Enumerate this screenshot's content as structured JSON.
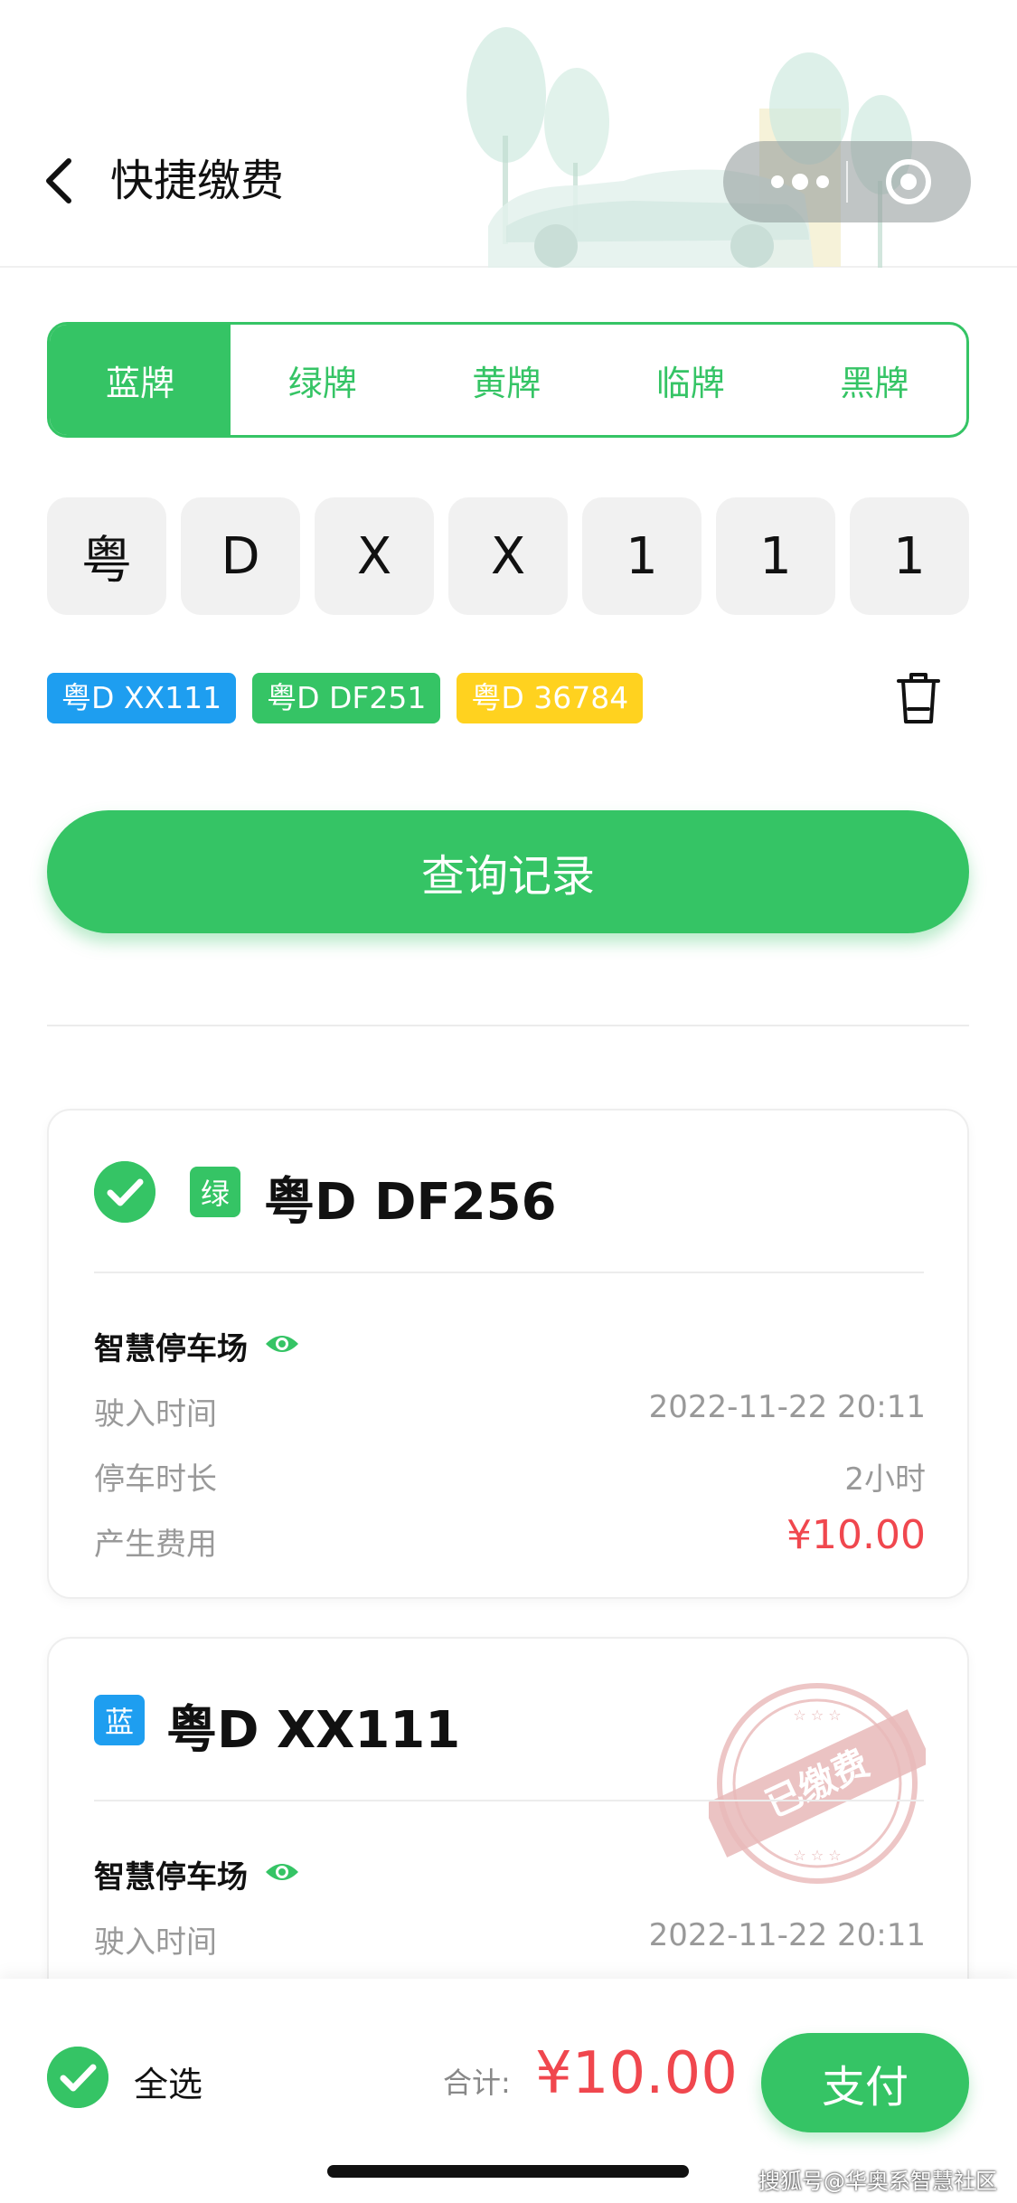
{
  "header": {
    "title": "快捷缴费"
  },
  "plate_tabs": [
    {
      "label": "蓝牌",
      "active": true
    },
    {
      "label": "绿牌",
      "active": false
    },
    {
      "label": "黄牌",
      "active": false
    },
    {
      "label": "临牌",
      "active": false
    },
    {
      "label": "黑牌",
      "active": false
    }
  ],
  "plate_input": [
    "粤",
    "D",
    "X",
    "X",
    "1",
    "1",
    "1"
  ],
  "history": [
    {
      "label": "粤D XX111",
      "color": "#1e9ef0"
    },
    {
      "label": "粤D DF251",
      "color": "#35c465"
    },
    {
      "label": "粤D 36784",
      "color": "#ffd21f"
    }
  ],
  "query_button": "查询记录",
  "records": [
    {
      "selected": true,
      "plate_type": "绿",
      "plate_type_color": "#35c465",
      "plate": "粤D DF256",
      "lot": "智慧停车场",
      "entry_label": "驶入时间",
      "entry_time": "2022-11-22 20:11",
      "duration_label": "停车时长",
      "duration": "2小时",
      "fee_label": "产生费用",
      "fee": "¥10.00"
    },
    {
      "selected": false,
      "paid": true,
      "stamp_text": "已缴费",
      "plate_type": "蓝",
      "plate_type_color": "#1e9ef0",
      "plate": "粤D XX111",
      "lot": "智慧停车场",
      "entry_label": "驶入时间",
      "entry_time": "2022-11-22 20:11"
    }
  ],
  "footer": {
    "select_all": "全选",
    "total_label": "合计:",
    "total_amount": "¥10.00",
    "pay_button": "支付"
  },
  "watermark": "搜狐号@华奥系智慧社区",
  "colors": {
    "primary": "#35c465",
    "price": "#f0474e",
    "blue_plate": "#1e9ef0",
    "yellow_plate": "#ffd21f"
  }
}
